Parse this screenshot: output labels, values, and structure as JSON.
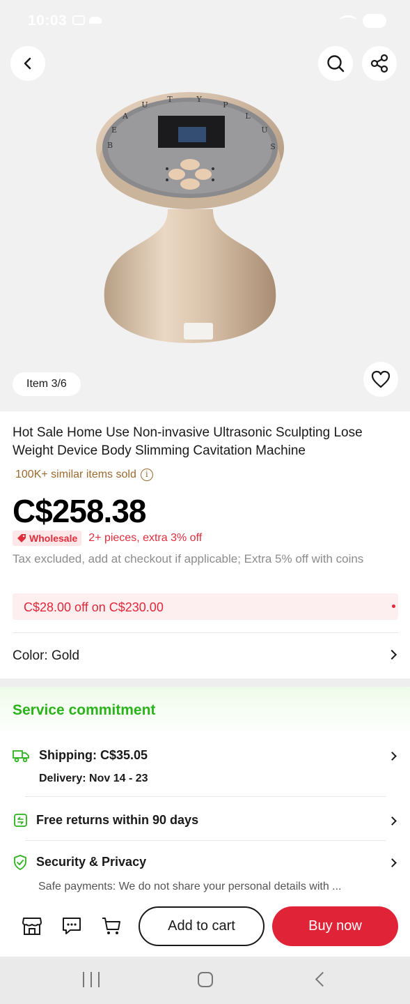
{
  "status_bar": {
    "time": "10:03"
  },
  "header": {
    "back_icon": "chevron-left-icon",
    "search_icon": "search-icon",
    "share_icon": "share-icon"
  },
  "gallery": {
    "item_counter": "Item 3/6",
    "wishlist_icon": "heart-icon",
    "device_lettering": "BEAUTY PLUS"
  },
  "product": {
    "title": "Hot Sale Home Use Non-invasive Ultrasonic Sculpting Lose Weight Device Body Slimming Cavitation Machine",
    "sold": "100K+ similar items sold",
    "price": "C$258.38",
    "wholesale_badge": "Wholesale",
    "wholesale_offer": "2+ pieces, extra 3% off",
    "tax_note": "Tax excluded, add at checkout if applicable; Extra 5% off with coins",
    "coupon": "C$28.00 off on C$230.00",
    "color_label": "Color: Gold"
  },
  "service": {
    "title": "Service commitment",
    "shipping": "Shipping: C$35.05",
    "delivery": "Delivery: Nov 14 - 23",
    "returns": "Free returns within 90 days",
    "security": "Security & Privacy",
    "security_sub": "Safe payments: We do not share your personal details with ..."
  },
  "bottom_bar": {
    "store_icon": "store-icon",
    "chat_icon": "chat-icon",
    "cart_icon": "cart-icon",
    "add_to_cart": "Add to cart",
    "buy_now": "Buy now"
  },
  "colors": {
    "accent_red": "#e02336",
    "service_green": "#2bb31a",
    "sold_brown": "#9c6a2f"
  }
}
